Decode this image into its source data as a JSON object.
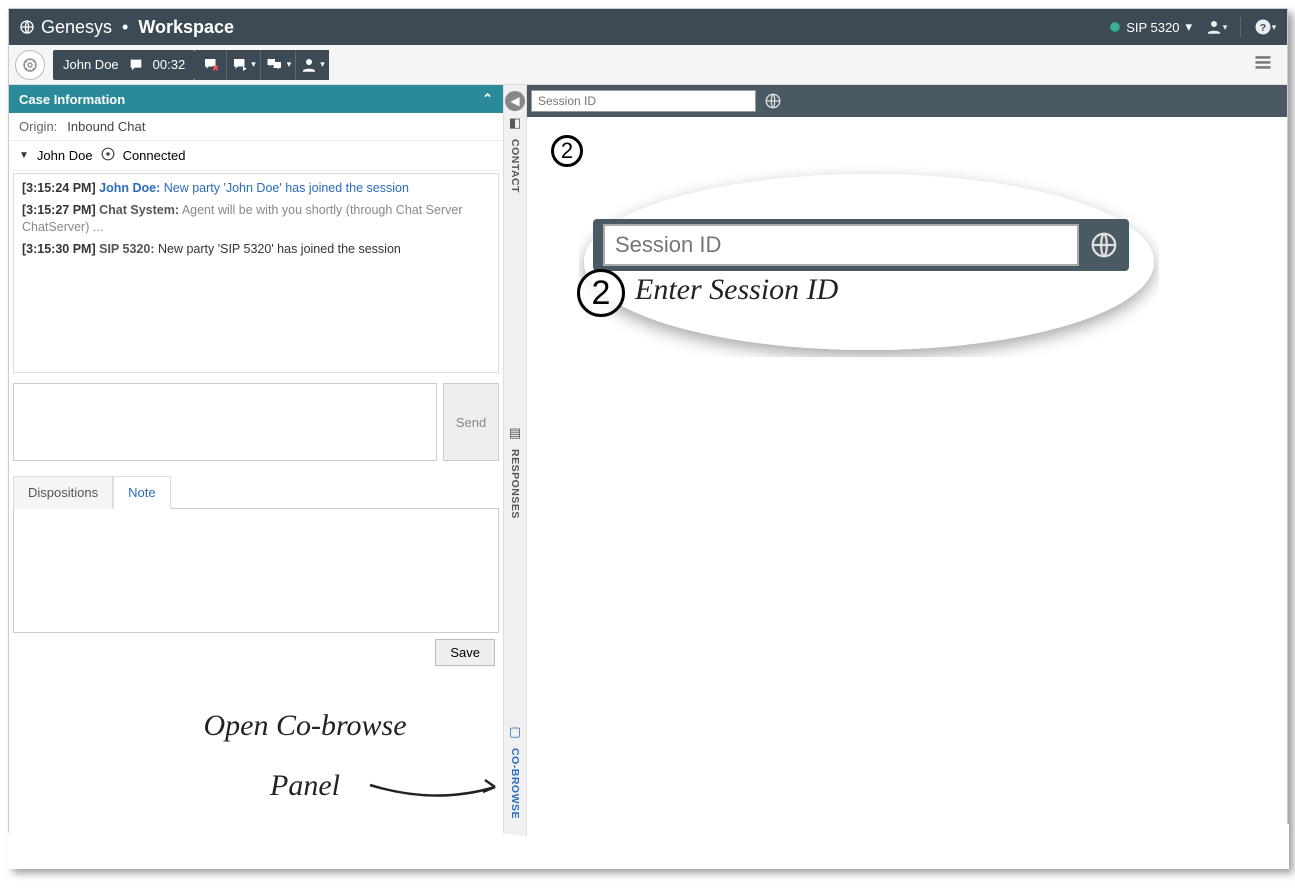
{
  "header": {
    "brand": "Genesys",
    "product": "Workspace",
    "agent_name": "SIP 5320"
  },
  "toolbar": {
    "contact_name": "John Doe",
    "timer": "00:32"
  },
  "case": {
    "title": "Case Information",
    "origin_label": "Origin:",
    "origin_value": "Inbound Chat"
  },
  "participant": {
    "name": "John Doe",
    "status": "Connected"
  },
  "transcript": [
    {
      "time": "[3:15:24 PM]",
      "name": "John Doe:",
      "text": "New party 'John Doe' has joined the session",
      "style": "blue"
    },
    {
      "time": "[3:15:27 PM]",
      "name": "Chat System:",
      "text": "Agent will be with you shortly (through Chat Server ChatServer) ...",
      "style": "gray"
    },
    {
      "time": "[3:15:30 PM]",
      "name": "SIP 5320:",
      "text": "New party 'SIP 5320' has joined the session",
      "style": "grayname"
    }
  ],
  "compose": {
    "send_label": "Send"
  },
  "tabs": {
    "dispositions": "Dispositions",
    "note": "Note",
    "save_label": "Save"
  },
  "rail": {
    "contact": "CONTACT",
    "responses": "RESPONSES",
    "cobrowse": "CO-BROWSE"
  },
  "session": {
    "placeholder_small": "Session ID",
    "placeholder_zoom": "Session ID"
  },
  "annotations": {
    "num": "2",
    "enter_session": "Enter Session ID",
    "open_panel_1": "Open Co-browse",
    "open_panel_2": "Panel"
  }
}
